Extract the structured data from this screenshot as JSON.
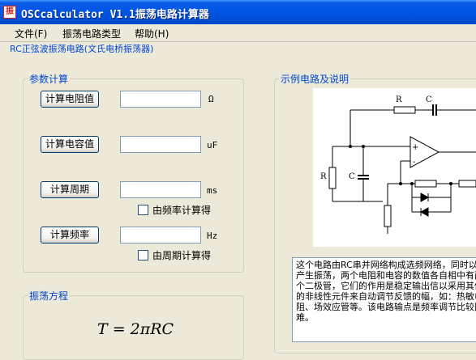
{
  "window": {
    "icon_glyph": "振",
    "title": "OSCcalculator V1.1振荡电路计算器"
  },
  "menu": {
    "items": [
      "文件(F)",
      "振荡电路类型",
      "帮助(H)"
    ]
  },
  "subtitle": "RC正弦波振荡电路(文氏电桥振荡器)",
  "params": {
    "group_title": "参数计算",
    "rows": [
      {
        "button": "计算电阻值",
        "value": "",
        "unit": "Ω"
      },
      {
        "button": "计算电容值",
        "value": "",
        "unit": "uF"
      },
      {
        "button": "计算周期",
        "value": "",
        "unit": "ms"
      },
      {
        "button": "计算频率",
        "value": "",
        "unit": "Hz"
      }
    ],
    "check_from_freq": "由频率计算得",
    "check_from_period": "由周期计算得"
  },
  "equation": {
    "group_title": "振荡方程",
    "formula": "T = 2πRC"
  },
  "example": {
    "group_title": "示例电路及说明",
    "labels": {
      "r_top": "R",
      "c_top": "C",
      "r_left": "R",
      "c_left": "C",
      "plus": "+",
      "minus": "-"
    },
    "description": "这个电路由RC串并网络构成选频网络，同时以产生振荡，两个电阻和电容的数值各自相中有两个二极管，它们的作用是稳定输出信以采用其他的非线性元件来自动调节反馈的幅，如：热敏电阻、场效应管等。该电路输点是频率调节比较困难。"
  },
  "colors": {
    "group_title": "#0046d5",
    "titlebar": "#0054e3",
    "window_bg": "#ece9d8"
  }
}
